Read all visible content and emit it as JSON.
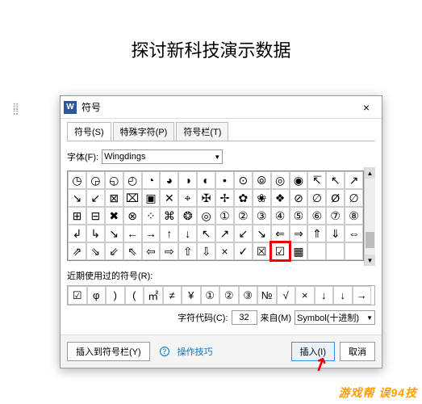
{
  "doc_title": "探讨新科技演示数据",
  "dialog": {
    "title": "符号",
    "close": "×",
    "tabs": [
      "符号(S)",
      "特殊字符(P)",
      "符号栏(T)"
    ],
    "font_label": "字体(F):",
    "font_value": "Wingdings",
    "grid": [
      [
        "◷",
        "◶",
        "◵",
        "◴",
        "◔",
        "◕",
        "◑",
        "◐",
        "•",
        "⊙",
        "⦾",
        "◎",
        "◉",
        "↸",
        "↖",
        "↗"
      ],
      [
        "↘",
        "↙",
        "⊠",
        "⌧",
        "▣",
        "✕",
        "⌖",
        "✠",
        "✢",
        "✿",
        "❀",
        "❖",
        "⊘",
        "∅",
        "Ø",
        "∅"
      ],
      [
        "⊞",
        "⊟",
        "✖",
        "⊗",
        "⁘",
        "⌘",
        "❂",
        "◎",
        "①",
        "②",
        "③",
        "④",
        "⑤",
        "⑥",
        "⑦",
        "⑧"
      ],
      [
        "↲",
        "↳",
        "↘",
        "←",
        "→",
        "↑",
        "↓",
        "↖",
        "↗",
        "↙",
        "↘",
        "⇐",
        "⇒",
        "⇑",
        "⇓",
        "⇔"
      ],
      [
        "⇗",
        "⇘",
        "⇙",
        "⇖",
        "⇦",
        "⇨",
        "⇧",
        "⇩",
        "×",
        "✓",
        "☒",
        "☑",
        "▦",
        "",
        "",
        ""
      ]
    ],
    "highlight_row": 4,
    "highlight_col": 11,
    "recent_label": "近期使用过的符号(R):",
    "recent": [
      "☑",
      "φ",
      ")",
      "(",
      "㎡",
      "≠",
      "¥",
      "①",
      "②",
      "③",
      "№",
      "√",
      "×",
      "↓",
      "↓",
      "→"
    ],
    "code_label": "字符代码(C):",
    "code_value": "32",
    "from_label": "来自(M)",
    "from_value": "Symbol(十进制)",
    "insert_toolbar": "插入到符号栏(Y)",
    "tips": "操作技巧",
    "insert": "插入(I)",
    "cancel": "取消"
  },
  "watermark": "游戏帮 误94技"
}
